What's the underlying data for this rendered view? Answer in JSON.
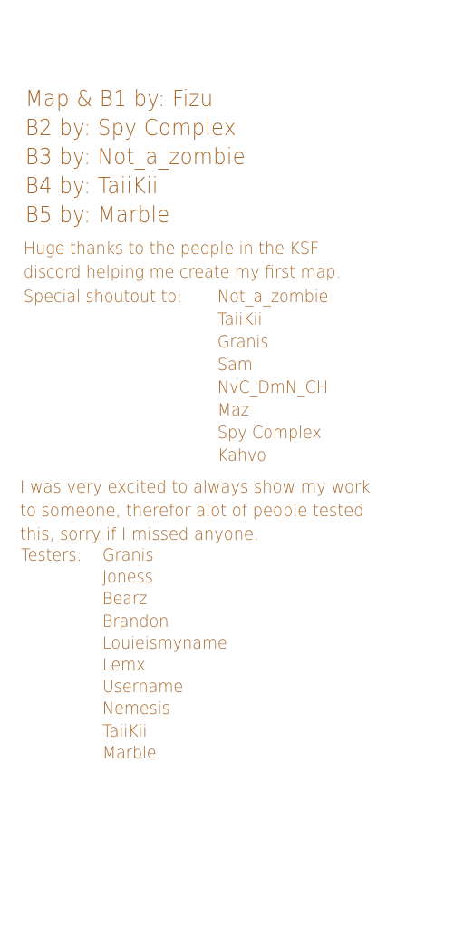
{
  "credits": [
    "Map & B1 by: Fizu",
    "B2 by: Spy Complex",
    "B3 by: Not_a_zombie",
    "B4 by: TaiiKii",
    "B5 by: Marble"
  ],
  "thanks": {
    "line1": "Huge thanks to the people in the KSF",
    "line2": "discord helping me create my first map."
  },
  "shoutout": {
    "label": "Special shoutout to:",
    "names": [
      "Not_a_zombie",
      "TaiiKii",
      "Granis",
      "Sam",
      "NvC_DmN_CH",
      "Maz",
      "Spy Complex",
      "Kahvo"
    ]
  },
  "note": {
    "line1": "I was very excited to always show my work",
    "line2": "to someone, therefor alot of people tested",
    "line3": "this, sorry if I missed anyone."
  },
  "testers": {
    "label": "Testers:",
    "names": [
      "Granis",
      "Joness",
      "Bearz",
      "Brandon",
      "Louieismyname",
      "Lemx",
      "Username",
      "Nemesis",
      "TaiiKii",
      "Marble"
    ]
  }
}
